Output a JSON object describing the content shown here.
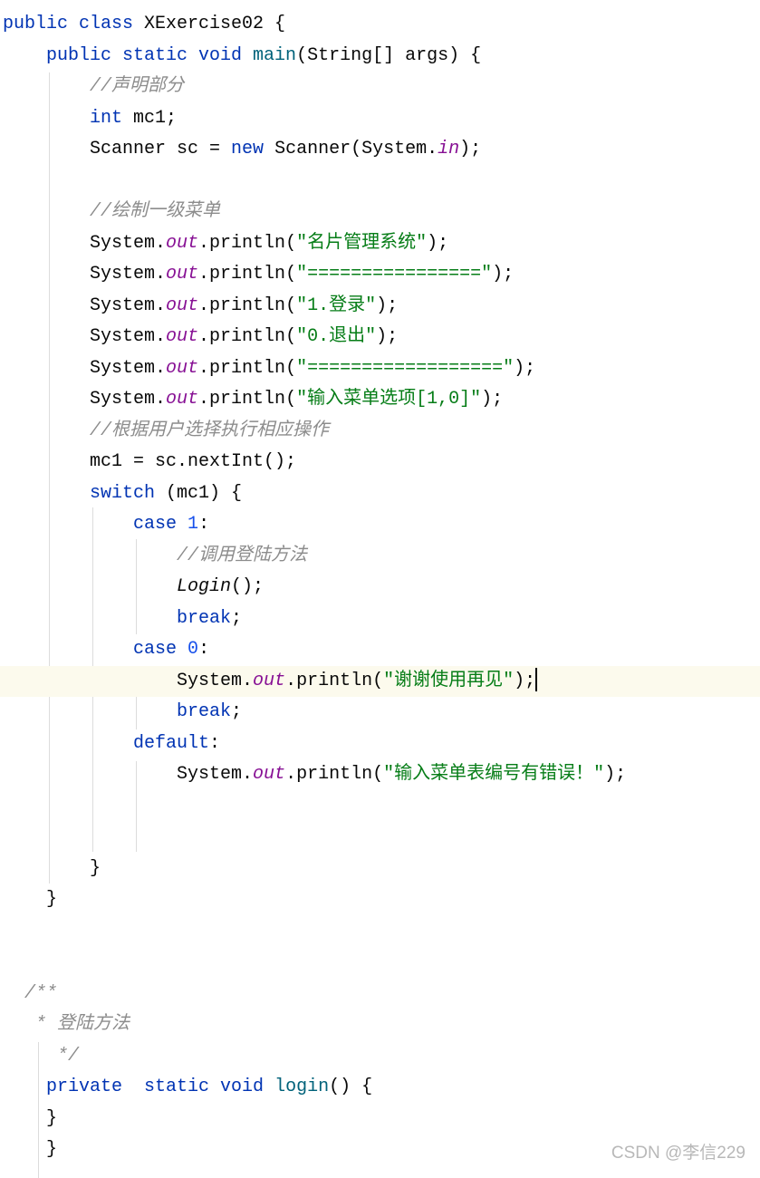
{
  "editor": {
    "lines": [
      [
        {
          "t": "public class ",
          "c": "kw"
        },
        {
          "t": "XExercise02 {",
          "c": "plain"
        }
      ],
      [
        {
          "t": "    public static void ",
          "c": "kw"
        },
        {
          "t": "main",
          "c": "fn"
        },
        {
          "t": "(String[] args) {",
          "c": "plain"
        }
      ],
      [
        {
          "t": "        //声明部分",
          "c": "com"
        }
      ],
      [
        {
          "t": "        ",
          "c": "plain"
        },
        {
          "t": "int ",
          "c": "kw"
        },
        {
          "t": "mc1;",
          "c": "plain"
        }
      ],
      [
        {
          "t": "        Scanner sc = ",
          "c": "plain"
        },
        {
          "t": "new ",
          "c": "kw"
        },
        {
          "t": "Scanner(System.",
          "c": "plain"
        },
        {
          "t": "in",
          "c": "field"
        },
        {
          "t": ");",
          "c": "plain"
        }
      ],
      [],
      [
        {
          "t": "        //绘制一级菜单",
          "c": "com"
        }
      ],
      [
        {
          "t": "        System.",
          "c": "plain"
        },
        {
          "t": "out",
          "c": "field"
        },
        {
          "t": ".println(",
          "c": "plain"
        },
        {
          "t": "\"名片管理系统\"",
          "c": "str"
        },
        {
          "t": ");",
          "c": "plain"
        }
      ],
      [
        {
          "t": "        System.",
          "c": "plain"
        },
        {
          "t": "out",
          "c": "field"
        },
        {
          "t": ".println(",
          "c": "plain"
        },
        {
          "t": "\"================\"",
          "c": "str"
        },
        {
          "t": ");",
          "c": "plain"
        }
      ],
      [
        {
          "t": "        System.",
          "c": "plain"
        },
        {
          "t": "out",
          "c": "field"
        },
        {
          "t": ".println(",
          "c": "plain"
        },
        {
          "t": "\"1.登录\"",
          "c": "str"
        },
        {
          "t": ");",
          "c": "plain"
        }
      ],
      [
        {
          "t": "        System.",
          "c": "plain"
        },
        {
          "t": "out",
          "c": "field"
        },
        {
          "t": ".println(",
          "c": "plain"
        },
        {
          "t": "\"0.退出\"",
          "c": "str"
        },
        {
          "t": ");",
          "c": "plain"
        }
      ],
      [
        {
          "t": "        System.",
          "c": "plain"
        },
        {
          "t": "out",
          "c": "field"
        },
        {
          "t": ".println(",
          "c": "plain"
        },
        {
          "t": "\"==================\"",
          "c": "str"
        },
        {
          "t": ");",
          "c": "plain"
        }
      ],
      [
        {
          "t": "        System.",
          "c": "plain"
        },
        {
          "t": "out",
          "c": "field"
        },
        {
          "t": ".println(",
          "c": "plain"
        },
        {
          "t": "\"输入菜单选项[1,0]\"",
          "c": "str"
        },
        {
          "t": ");",
          "c": "plain"
        }
      ],
      [
        {
          "t": "        //根据用户选择执行相应操作",
          "c": "com"
        }
      ],
      [
        {
          "t": "        mc1 = sc.nextInt();",
          "c": "plain"
        }
      ],
      [
        {
          "t": "        ",
          "c": "plain"
        },
        {
          "t": "switch ",
          "c": "kw"
        },
        {
          "t": "(mc1) {",
          "c": "plain"
        }
      ],
      [
        {
          "t": "            ",
          "c": "plain"
        },
        {
          "t": "case ",
          "c": "kw"
        },
        {
          "t": "1",
          "c": "num"
        },
        {
          "t": ":",
          "c": "plain"
        }
      ],
      [
        {
          "t": "                //调用登陆方法",
          "c": "com"
        }
      ],
      [
        {
          "t": "                ",
          "c": "plain"
        },
        {
          "t": "Login",
          "c": "call-static"
        },
        {
          "t": "();",
          "c": "plain"
        }
      ],
      [
        {
          "t": "                ",
          "c": "plain"
        },
        {
          "t": "break",
          "c": "kw"
        },
        {
          "t": ";",
          "c": "plain"
        }
      ],
      [
        {
          "t": "            ",
          "c": "plain"
        },
        {
          "t": "case ",
          "c": "kw"
        },
        {
          "t": "0",
          "c": "num"
        },
        {
          "t": ":",
          "c": "plain"
        }
      ],
      [
        {
          "t": "                System.",
          "c": "plain"
        },
        {
          "t": "out",
          "c": "field"
        },
        {
          "t": ".println(",
          "c": "plain"
        },
        {
          "t": "\"谢谢使用再见\"",
          "c": "str"
        },
        {
          "t": ");",
          "c": "plain"
        }
      ],
      [
        {
          "t": "                ",
          "c": "plain"
        },
        {
          "t": "break",
          "c": "kw"
        },
        {
          "t": ";",
          "c": "plain"
        }
      ],
      [
        {
          "t": "            ",
          "c": "plain"
        },
        {
          "t": "default",
          "c": "kw"
        },
        {
          "t": ":",
          "c": "plain"
        }
      ],
      [
        {
          "t": "                System.",
          "c": "plain"
        },
        {
          "t": "out",
          "c": "field"
        },
        {
          "t": ".println(",
          "c": "plain"
        },
        {
          "t": "\"输入菜单表编号有错误！\"",
          "c": "str"
        },
        {
          "t": ");",
          "c": "plain"
        }
      ],
      [],
      [],
      [
        {
          "t": "        }",
          "c": "plain"
        }
      ],
      [
        {
          "t": "    }",
          "c": "plain"
        }
      ],
      [],
      [],
      [
        {
          "t": "  /**",
          "c": "com"
        }
      ],
      [
        {
          "t": "   * 登陆方法",
          "c": "com"
        }
      ],
      [
        {
          "t": "     */",
          "c": "com"
        }
      ],
      [
        {
          "t": "    ",
          "c": "plain"
        },
        {
          "t": "private  static void ",
          "c": "kw"
        },
        {
          "t": "login",
          "c": "fn"
        },
        {
          "t": "() {",
          "c": "plain"
        }
      ],
      [
        {
          "t": "    }",
          "c": "plain"
        }
      ],
      [
        {
          "t": "    }",
          "c": "plain"
        }
      ]
    ],
    "current_line": 21,
    "colors": {
      "keyword": "#0033b3",
      "method": "#00627a",
      "string": "#067d17",
      "comment": "#8c8c8c",
      "field": "#871094",
      "number": "#1750eb",
      "current_line_bg": "#fcfaed"
    }
  },
  "watermark": "CSDN @李信229"
}
